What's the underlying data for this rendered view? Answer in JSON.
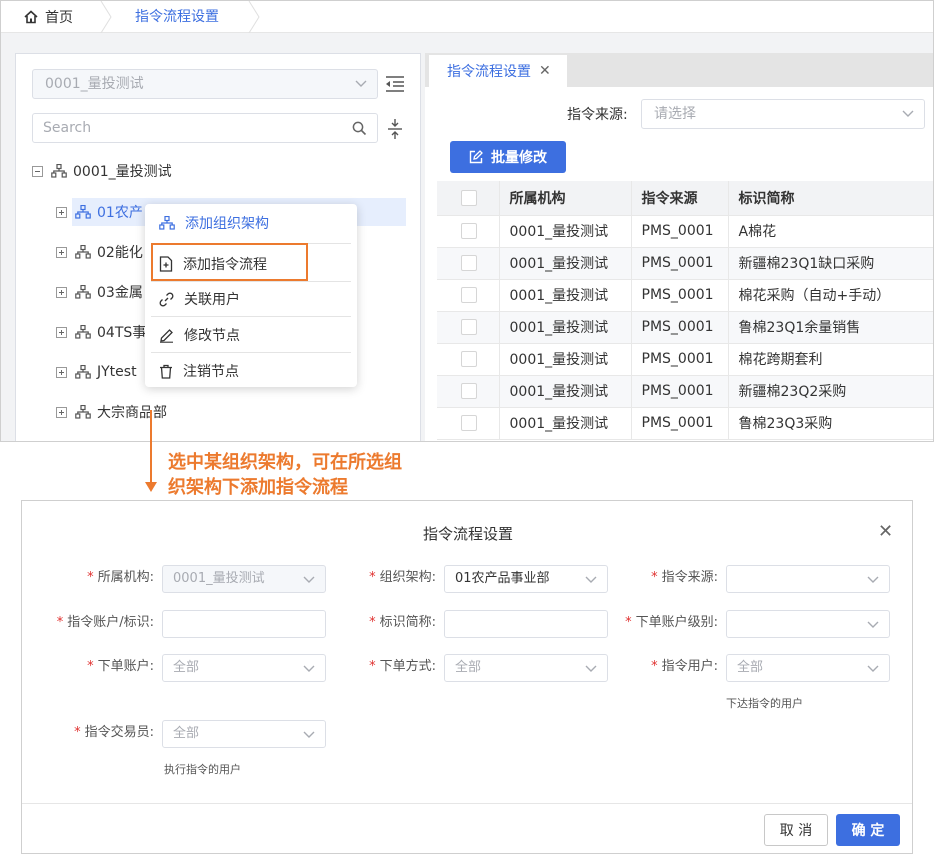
{
  "breadcrumb": {
    "home": "首页",
    "current": "指令流程设置"
  },
  "left": {
    "org_select": "0001_量投测试",
    "search_placeholder": "Search",
    "tree": {
      "root": "0001_量投测试",
      "children": [
        "01农产",
        "02能化",
        "03金属",
        "04TS事",
        "JYtest",
        "大宗商品部"
      ]
    }
  },
  "context_menu": {
    "items": [
      "添加组织架构",
      "添加指令流程",
      "关联用户",
      "修改节点",
      "注销节点"
    ]
  },
  "right": {
    "tab": "指令流程设置",
    "source_label": "指令来源:",
    "source_placeholder": "请选择",
    "batch_button": "批量修改",
    "columns": [
      "所属机构",
      "指令来源",
      "标识简称"
    ],
    "rows": [
      [
        "0001_量投测试",
        "PMS_0001",
        "A棉花"
      ],
      [
        "0001_量投测试",
        "PMS_0001",
        "新疆棉23Q1缺口采购"
      ],
      [
        "0001_量投测试",
        "PMS_0001",
        "棉花采购（自动+手动）"
      ],
      [
        "0001_量投测试",
        "PMS_0001",
        "鲁棉23Q1余量销售"
      ],
      [
        "0001_量投测试",
        "PMS_0001",
        "棉花跨期套利"
      ],
      [
        "0001_量投测试",
        "PMS_0001",
        "新疆棉23Q2采购"
      ],
      [
        "0001_量投测试",
        "PMS_0001",
        "鲁棉23Q3采购"
      ]
    ]
  },
  "annotation": {
    "line1": "选中某组织架构，可在所选组",
    "line2": "织架构下添加指令流程"
  },
  "dialog": {
    "title": "指令流程设置",
    "fields": {
      "org": {
        "label": "所属机构:",
        "value": "0001_量投测试"
      },
      "structure": {
        "label": "组织架构:",
        "value": "01农产品事业部"
      },
      "source": {
        "label": "指令来源:",
        "value": ""
      },
      "account": {
        "label": "指令账户/标识:",
        "value": ""
      },
      "short_name": {
        "label": "标识简称:",
        "value": ""
      },
      "order_level": {
        "label": "下单账户级别:",
        "value": ""
      },
      "order_account": {
        "label": "下单账户:",
        "placeholder": "全部"
      },
      "order_method": {
        "label": "下单方式:",
        "placeholder": "全部"
      },
      "cmd_user": {
        "label": "指令用户:",
        "placeholder": "全部",
        "hint": "下达指令的用户"
      },
      "trader": {
        "label": "指令交易员:",
        "placeholder": "全部",
        "hint": "执行指令的用户"
      }
    },
    "cancel": "取 消",
    "ok": "确 定"
  },
  "colors": {
    "accent": "#3d6fe0",
    "annotation": "#ec7a2e",
    "required": "#e0302f"
  }
}
